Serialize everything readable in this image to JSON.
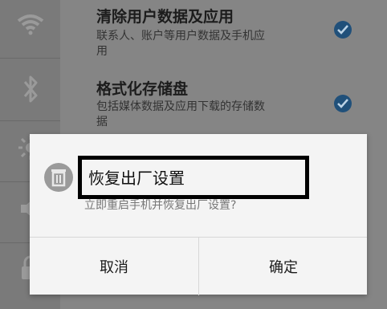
{
  "options": [
    {
      "title": "清除用户数据及应用",
      "desc_line1": "联系人、账户等用户数据及手机应",
      "desc_line2": "用",
      "checked": true
    },
    {
      "title": "格式化存储盘",
      "desc_line1": "包括媒体数据及应用下载的存储数",
      "desc_line2": "据",
      "checked": true
    }
  ],
  "dialog": {
    "title": "恢复出厂设置",
    "subtitle": "立即重启手机并恢复出厂设置?",
    "cancel_label": "取消",
    "confirm_label": "确定",
    "icon": "trash-icon"
  },
  "rail_icons": [
    "wifi-icon",
    "bluetooth-icon",
    "brightness-icon",
    "volume-icon",
    "lock-icon"
  ],
  "colors": {
    "check": "#20507a",
    "dialog_bg": "#f4f4f4"
  }
}
